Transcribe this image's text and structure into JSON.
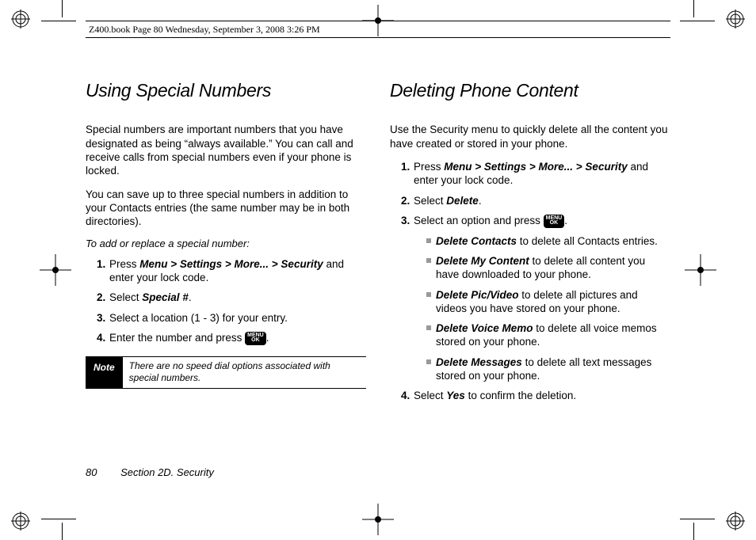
{
  "header": "Z400.book  Page 80  Wednesday, September 3, 2008  3:26 PM",
  "left": {
    "title": "Using Special Numbers",
    "p1": "Special numbers are important numbers that you have designated as being “always available.” You can call and receive calls from special numbers even if your phone is locked.",
    "p2": "You can save up to three special numbers in addition to your Contacts entries (the same number may be in both directories).",
    "subhead": "To add or replace a special number:",
    "steps": {
      "s1a": "Press ",
      "s1b": "Menu > Settings > More... > Security",
      "s1c": " and enter your lock code.",
      "s2a": "Select ",
      "s2b": "Special #",
      "s2c": ".",
      "s3": "Select a location (1 - 3) for your entry.",
      "s4a": "Enter the number and press ",
      "s4b": "."
    },
    "note_label": "Note",
    "note_text": "There are no speed dial options associated with special numbers."
  },
  "right": {
    "title": "Deleting Phone Content",
    "p1": "Use the Security menu to quickly delete all the content you have created or stored in your phone.",
    "steps": {
      "s1a": "Press ",
      "s1b": "Menu > Settings > More... > Security",
      "s1c": " and enter your lock code.",
      "s2a": "Select ",
      "s2b": "Delete",
      "s2c": ".",
      "s3a": "Select an option and press ",
      "s3b": ".",
      "s4a": "Select ",
      "s4b": "Yes",
      "s4c": " to confirm the deletion."
    },
    "opts": {
      "o1a": "Delete Contacts",
      "o1b": " to delete all Contacts entries.",
      "o2a": "Delete My Content",
      "o2b": " to delete all content you have downloaded to your phone.",
      "o3a": "Delete Pic/Video",
      "o3b": " to delete all pictures and videos you have stored on your phone.",
      "o4a": "Delete Voice Memo",
      "o4b": " to delete all voice memos stored on your phone.",
      "o5a": "Delete Messages",
      "o5b": " to delete all text messages stored on your phone."
    }
  },
  "menu_key_line1": "MENU",
  "menu_key_line2": "OK",
  "footer_page": "80",
  "footer_section": "Section 2D. Security"
}
